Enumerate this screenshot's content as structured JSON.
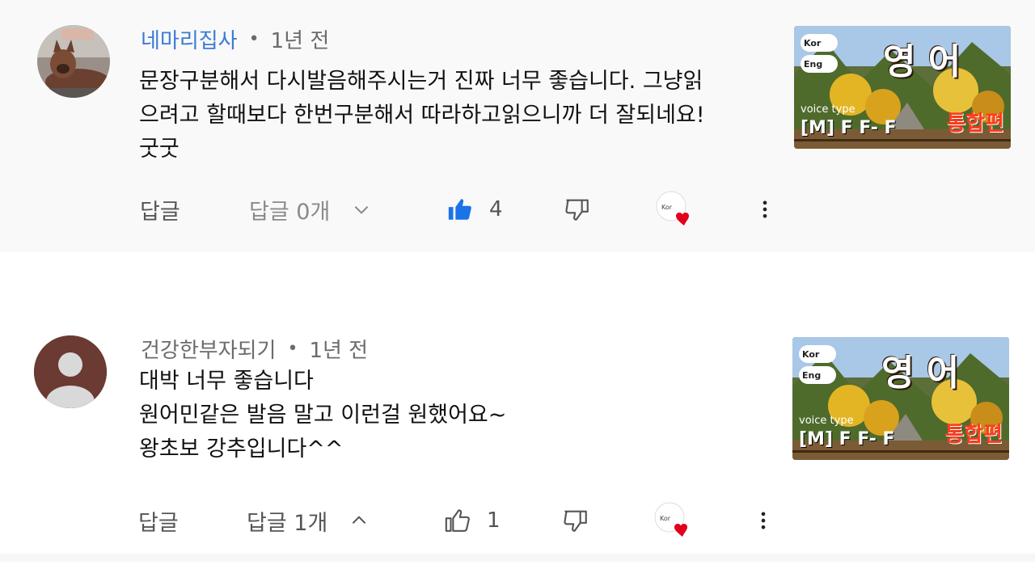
{
  "comments": [
    {
      "author": "네마리집사",
      "separator": "•",
      "time": "1년 전",
      "lines": [
        "문장구분해서 다시발음해주시는거 진짜 너무 좋습니다. 그냥읽",
        "으려고 할때보다 한번구분해서 따라하고읽으니까 더 잘되네요!",
        "굿굿"
      ],
      "reply_label": "답글",
      "replies_label": "답글 0개",
      "likes": "4",
      "liked": true,
      "expanded": false,
      "thumbnail": {
        "title": "영 어",
        "flag_top": "Kor",
        "flag_bottom": "Eng",
        "voice_type": "voice type",
        "voice_code": "[M] F F- F",
        "tag": "통합편"
      }
    },
    {
      "author": "건강한부자되기",
      "separator": "•",
      "time": "1년 전",
      "lines": [
        "대박 너무 좋습니다",
        "원어민같은 발음 말고 이런걸 원했어요~",
        "왕초보 강추입니다^^"
      ],
      "reply_label": "답글",
      "replies_label": "답글 1개",
      "likes": "1",
      "liked": false,
      "expanded": true,
      "thumbnail": {
        "title": "영 어",
        "flag_top": "Kor",
        "flag_bottom": "Eng",
        "voice_type": "voice type",
        "voice_code": "[M] F F- F",
        "tag": "통합편"
      }
    }
  ],
  "icons": {
    "like": "thumb-up-icon",
    "dislike": "thumb-down-icon",
    "heart": "creator-heart-icon",
    "more": "more-vert-icon",
    "expand": "chevron-down-icon",
    "collapse": "chevron-up-icon"
  },
  "colors": {
    "author_highlight": "#3a7bd5",
    "like_active": "#1a73e8",
    "heart": "#e0001b"
  }
}
